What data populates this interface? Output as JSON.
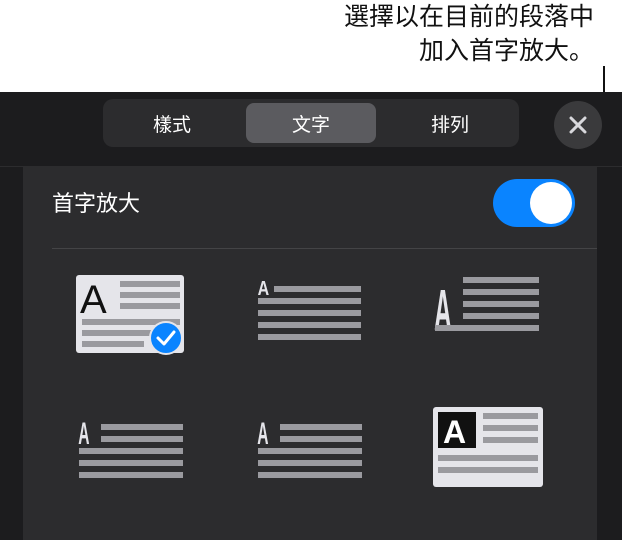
{
  "callout": {
    "line1": "選擇以在目前的段落中",
    "line2": "加入首字放大。"
  },
  "tabs": [
    {
      "label": "樣式",
      "selected": false
    },
    {
      "label": "文字",
      "selected": true
    },
    {
      "label": "排列",
      "selected": false
    }
  ],
  "close_icon": "close-icon",
  "drop_cap": {
    "label": "首字放大",
    "enabled": true
  },
  "styles": {
    "letter": "A",
    "selected_index": 0
  },
  "colors": {
    "accent": "#0a84ff",
    "panel": "#1c1c1e",
    "content": "#2c2c2e"
  }
}
